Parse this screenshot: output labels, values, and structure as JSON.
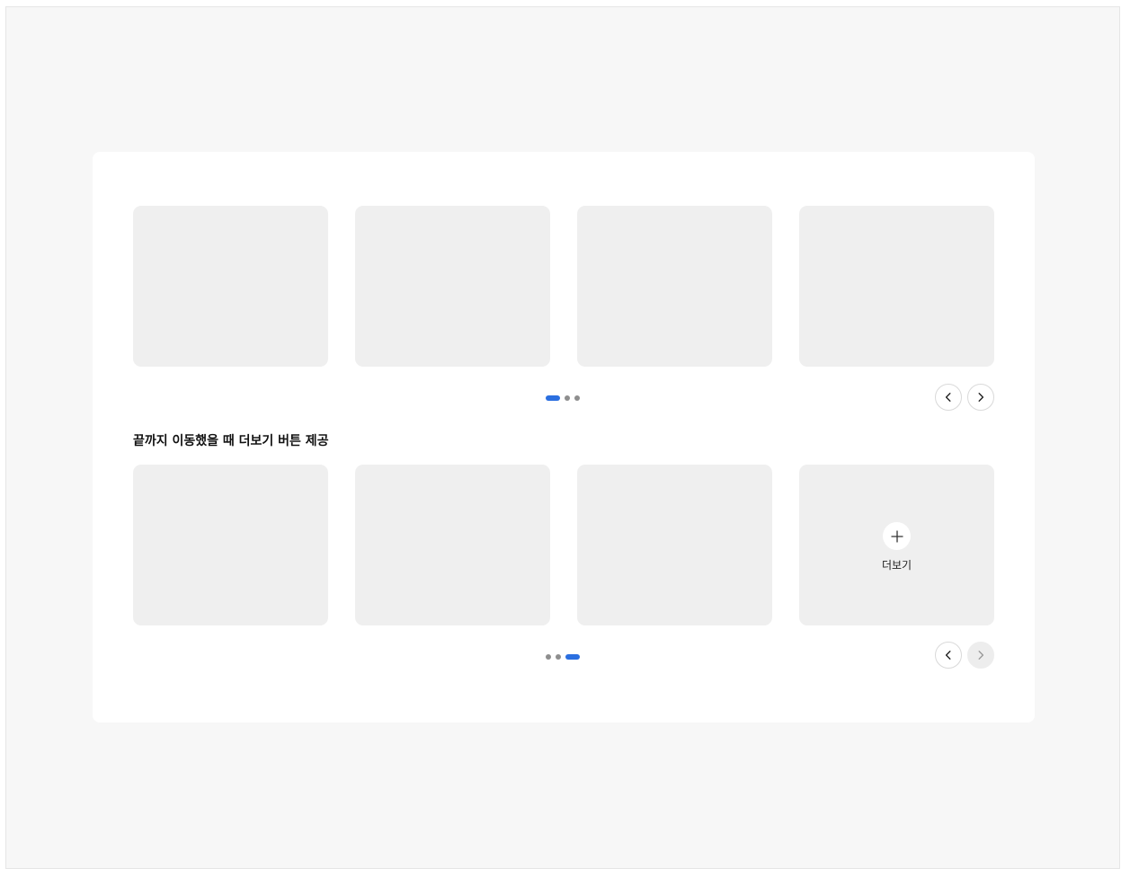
{
  "section2": {
    "title": "끝까지 이동했을 때 더보기 버튼 제공",
    "more_label": "더보기"
  },
  "carousel1": {
    "pagination": {
      "total": 3,
      "active_index": 0
    },
    "prev_enabled": true,
    "next_enabled": true
  },
  "carousel2": {
    "pagination": {
      "total": 3,
      "active_index": 2
    },
    "prev_enabled": true,
    "next_enabled": false
  },
  "icons": {
    "prev": "chevron-left-icon",
    "next": "chevron-right-icon",
    "more": "plus-icon"
  },
  "colors": {
    "accent": "#2b6fe0",
    "card": "#efefef",
    "background": "#f7f7f7"
  }
}
